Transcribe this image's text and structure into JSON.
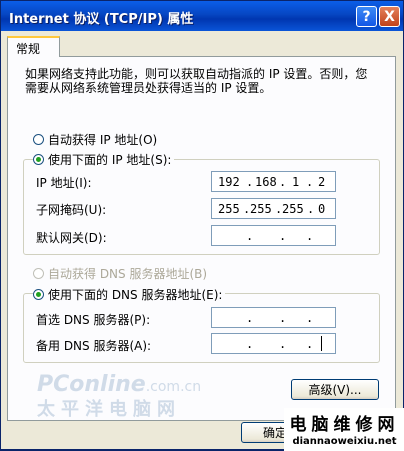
{
  "window": {
    "title": "Internet 协议 (TCP/IP) 属性",
    "help_glyph": "?",
    "close_glyph": "X"
  },
  "tab": {
    "label": "常规"
  },
  "description": "如果网络支持此功能，则可以获取自动指派的 IP 设置。否则，您需要从网络系统管理员处获得适当的 IP 设置。",
  "ip_section": {
    "auto_label": "自动获得 IP 地址(O)",
    "manual_label": "使用下面的 IP 地址(S):",
    "selected": "manual",
    "fields": [
      {
        "label": "IP 地址(I):",
        "octets": [
          "192",
          "168",
          "1",
          "2"
        ]
      },
      {
        "label": "子网掩码(U):",
        "octets": [
          "255",
          "255",
          "255",
          "0"
        ]
      },
      {
        "label": "默认网关(D):",
        "octets": [
          "",
          "",
          "",
          ""
        ]
      }
    ]
  },
  "dns_section": {
    "auto_label": "自动获得 DNS 服务器地址(B)",
    "manual_label": "使用下面的 DNS 服务器地址(E):",
    "selected": "manual",
    "fields": [
      {
        "label": "首选 DNS 服务器(P):",
        "octets": [
          "",
          "",
          "",
          ""
        ]
      },
      {
        "label": "备用 DNS 服务器(A):",
        "octets": [
          "",
          "",
          "",
          ""
        ]
      }
    ]
  },
  "buttons": {
    "advanced": "高级(V)...",
    "ok": "确定"
  },
  "watermarks": {
    "logo_main": "PConline",
    "logo_domain": ".com.cn",
    "logo_cn": "太平洋电脑网",
    "site_cn": "电脑维修网",
    "site_url": "diannaoweixiu.net"
  }
}
